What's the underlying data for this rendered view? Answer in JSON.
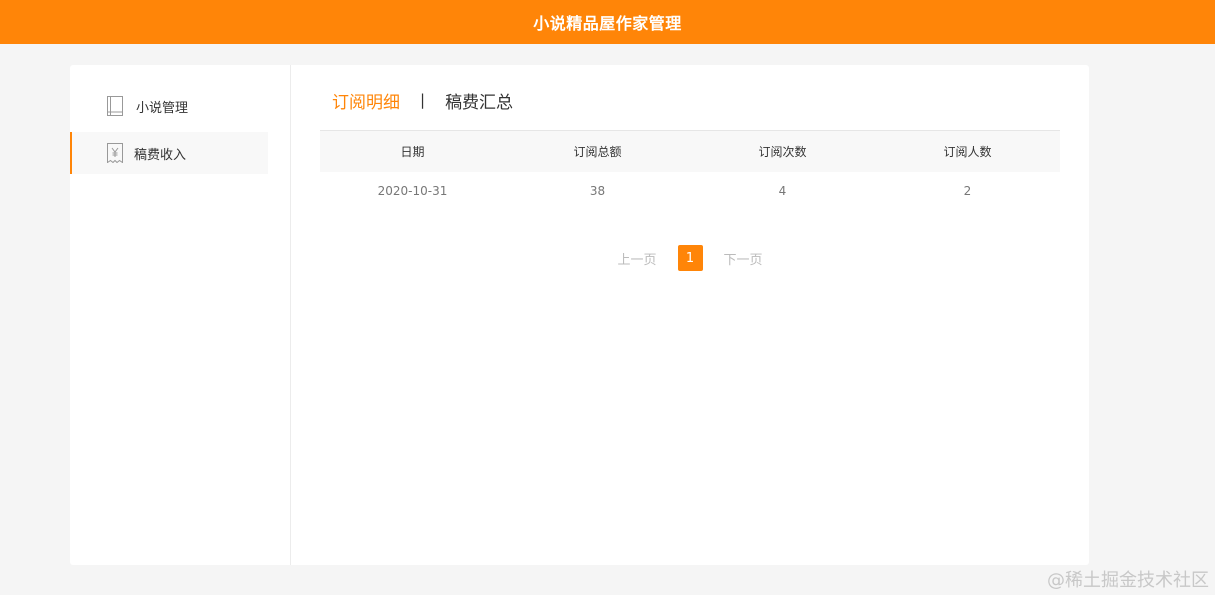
{
  "header": {
    "title": "小说精品屋作家管理"
  },
  "sidebar": {
    "items": [
      {
        "label": "小说管理",
        "icon": "book-icon",
        "active": false
      },
      {
        "label": "稿费收入",
        "icon": "yen-receipt-icon",
        "active": true
      }
    ]
  },
  "tabs": [
    {
      "label": "订阅明细",
      "active": true
    },
    {
      "label": "稿费汇总",
      "active": false
    }
  ],
  "tab_separator": "|",
  "table": {
    "columns": [
      "日期",
      "订阅总额",
      "订阅次数",
      "订阅人数"
    ],
    "rows": [
      [
        "2020-10-31",
        "38",
        "4",
        "2"
      ]
    ]
  },
  "pagination": {
    "prev": "上一页",
    "current": "1",
    "next": "下一页"
  },
  "watermark": "@稀土掘金技术社区",
  "colors": {
    "accent": "#ff8508",
    "background": "#f5f5f5"
  }
}
